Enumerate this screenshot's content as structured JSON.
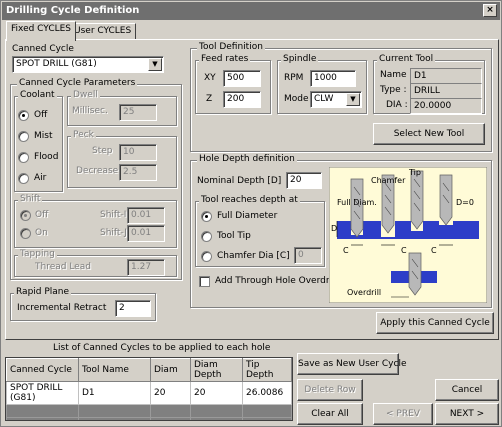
{
  "window": {
    "title": "Drilling Cycle Definition",
    "close_glyph": "×"
  },
  "tabs": [
    {
      "label": "Fixed CYCLES"
    },
    {
      "label": "User CYCLES"
    }
  ],
  "canned_cycle": {
    "label": "Canned Cycle",
    "value": "SPOT DRILL (G81)"
  },
  "params": {
    "label": "Canned Cycle Parameters",
    "coolant": {
      "label": "Coolant",
      "options": [
        "Off",
        "Mist",
        "Flood",
        "Air"
      ],
      "selected": "Off"
    },
    "dwell": {
      "label": "Dwell",
      "millisec_label": "Millisec.",
      "millisec_value": "25"
    },
    "peck": {
      "label": "Peck",
      "step_label": "Step",
      "step_value": "10",
      "decrease_label": "Decrease",
      "decrease_value": "2.5"
    },
    "shift": {
      "label": "Shift",
      "options": [
        "Off",
        "On"
      ],
      "shift_i_label": "Shift-I",
      "shift_i_value": "0.01",
      "shift_j_label": "Shift-J",
      "shift_j_value": "0.01"
    },
    "tapping": {
      "label": "Tapping",
      "thread_lead_label": "Thread Lead",
      "thread_lead_value": "1.27"
    },
    "rapid_plane": {
      "label": "Rapid Plane",
      "incremental_label": "Incremental Retract",
      "incremental_value": "2"
    }
  },
  "tool_definition": {
    "label": "Tool Definition",
    "feed_rates": {
      "label": "Feed rates",
      "xy_label": "XY",
      "xy_value": "500",
      "z_label": "Z",
      "z_value": "200"
    },
    "spindle": {
      "label": "Spindle",
      "rpm_label": "RPM",
      "rpm_value": "1000",
      "mode_label": "Mode",
      "mode_value": "CLW"
    },
    "current_tool": {
      "label": "Current Tool",
      "name_label": "Name :",
      "name_value": "D1",
      "type_label": "Type :",
      "type_value": "DRILL",
      "dia_label": "DIA :",
      "dia_value": "20.0000"
    },
    "select_new_tool": "Select New Tool"
  },
  "hole_depth": {
    "label": "Hole Depth definition",
    "nominal_label": "Nominal Depth [D]",
    "nominal_value": "20",
    "reaches_label": "Tool reaches depth at",
    "options": [
      "Full Diameter",
      "Tool Tip",
      "Chamfer Dia [C]"
    ],
    "selected": "Full Diameter",
    "chamfer_value": "0",
    "overdrill_label": "Add Through Hole Overdrill",
    "diagram": {
      "full_diam": "Full Diam.",
      "chamfer": "Chamfer",
      "tip": "Tip",
      "d": "D",
      "d0": "D=0",
      "c": "C",
      "overdrill": "Overdrill"
    }
  },
  "apply_button": "Apply this Canned Cycle",
  "list": {
    "title": "List of Canned Cycles to be applied to each hole",
    "columns": [
      "Canned Cycle",
      "Tool Name",
      "Diam",
      "Diam Depth",
      "Tip Depth"
    ],
    "rows": [
      [
        "SPOT DRILL (G81)",
        "D1",
        "20",
        "20",
        "26.0086"
      ]
    ]
  },
  "buttons": {
    "save_user": "Save as New User Cycle",
    "delete_row": "Delete Row",
    "clear_all": "Clear All",
    "cancel": "Cancel",
    "prev": "< PREV",
    "next": "NEXT >"
  },
  "colors": {
    "panel": "#d4d0c8",
    "diagram_bg": "#fffbd7",
    "part_blue": "#2d3ec8"
  }
}
